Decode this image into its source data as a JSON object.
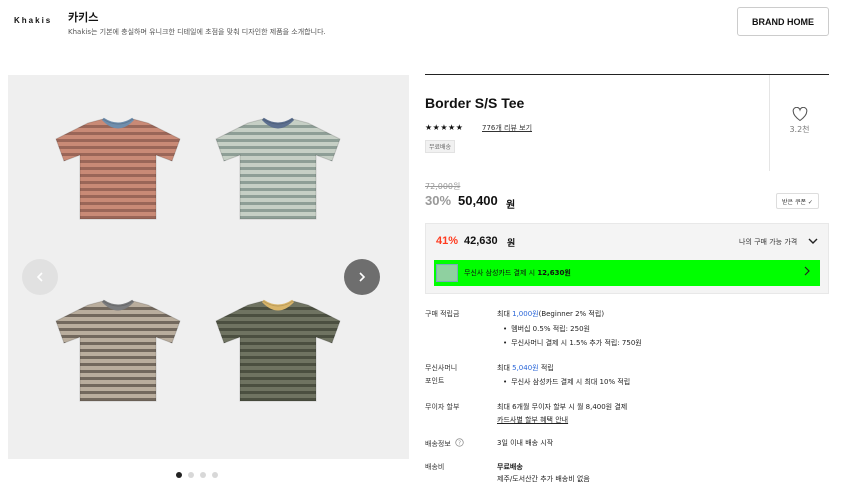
{
  "brand": {
    "logo": "Khakis",
    "name": "카키스",
    "description": "Khakis는 기본에 충실하며 유니크한 디테일에 초점을 맞춰 디자인한 제품을 소개합니다.",
    "home_button": "BRAND HOME"
  },
  "gallery": {
    "prev_icon": "chevron-left-icon",
    "next_icon": "chevron-right-icon",
    "slide_count": 4,
    "active_slide": 1,
    "shirts": [
      {
        "color": "#c98a76",
        "stripe": "#8a5a4f",
        "collar": "#6f8ead"
      },
      {
        "color": "#c6cfc5",
        "stripe": "#7b8d86",
        "collar": "#5c6f8f"
      },
      {
        "color": "#b9ad9d",
        "stripe": "#5b5148",
        "collar": "#7a7b7d"
      },
      {
        "color": "#6f7361",
        "stripe": "#3f4335",
        "collar": "#d9b56a"
      }
    ]
  },
  "product": {
    "title": "Border S/S Tee",
    "stars": "★★★★★",
    "reviews": "776개 리뷰 보기",
    "shipping_badge": "무료배송",
    "like_count": "3.2천",
    "original_price": "72,000원",
    "discount_rate": "30%",
    "price": "50,400",
    "price_unit": "원",
    "coupon_button": "받은 쿠폰 ✓"
  },
  "my_price": {
    "discount_rate": "41%",
    "price": "42,630",
    "price_unit": "원",
    "label": "나의 구매 가능 가격",
    "card_text_prefix": "무신사 삼성카드 결제 시 ",
    "card_text_amount": "12,630원",
    "card_bar_color": "#00ff00"
  },
  "details": {
    "points": {
      "label": "구매 적립금",
      "line1_prefix": "최대 ",
      "line1_amount": "1,000원",
      "line1_suffix": "(Beginner 2% 적립)",
      "bullets": [
        "멤버십 0.5% 적립: 250원",
        "무신사머니 결제 시 1.5% 추가 적립: 750원"
      ]
    },
    "money": {
      "label_line1": "무신사머니",
      "label_line2": "포인트",
      "line1_prefix": "최대 ",
      "line1_amount": "5,040원",
      "line1_suffix": " 적립",
      "bullets": [
        "무신사 삼성카드 결제 시 최대 10% 적립"
      ]
    },
    "installment": {
      "label": "무이자 할부",
      "line1": "최대 6개월 무이자 할부 시 월 8,400원 결제",
      "link": "카드사별 할부 혜택 안내"
    },
    "delivery_info": {
      "label": "배송정보",
      "value": "3일 이내 배송 시작"
    },
    "delivery_fee": {
      "label": "배송비",
      "value_bold": "무료배송",
      "value": "제주/도서산간 추가 배송비 없음"
    }
  }
}
